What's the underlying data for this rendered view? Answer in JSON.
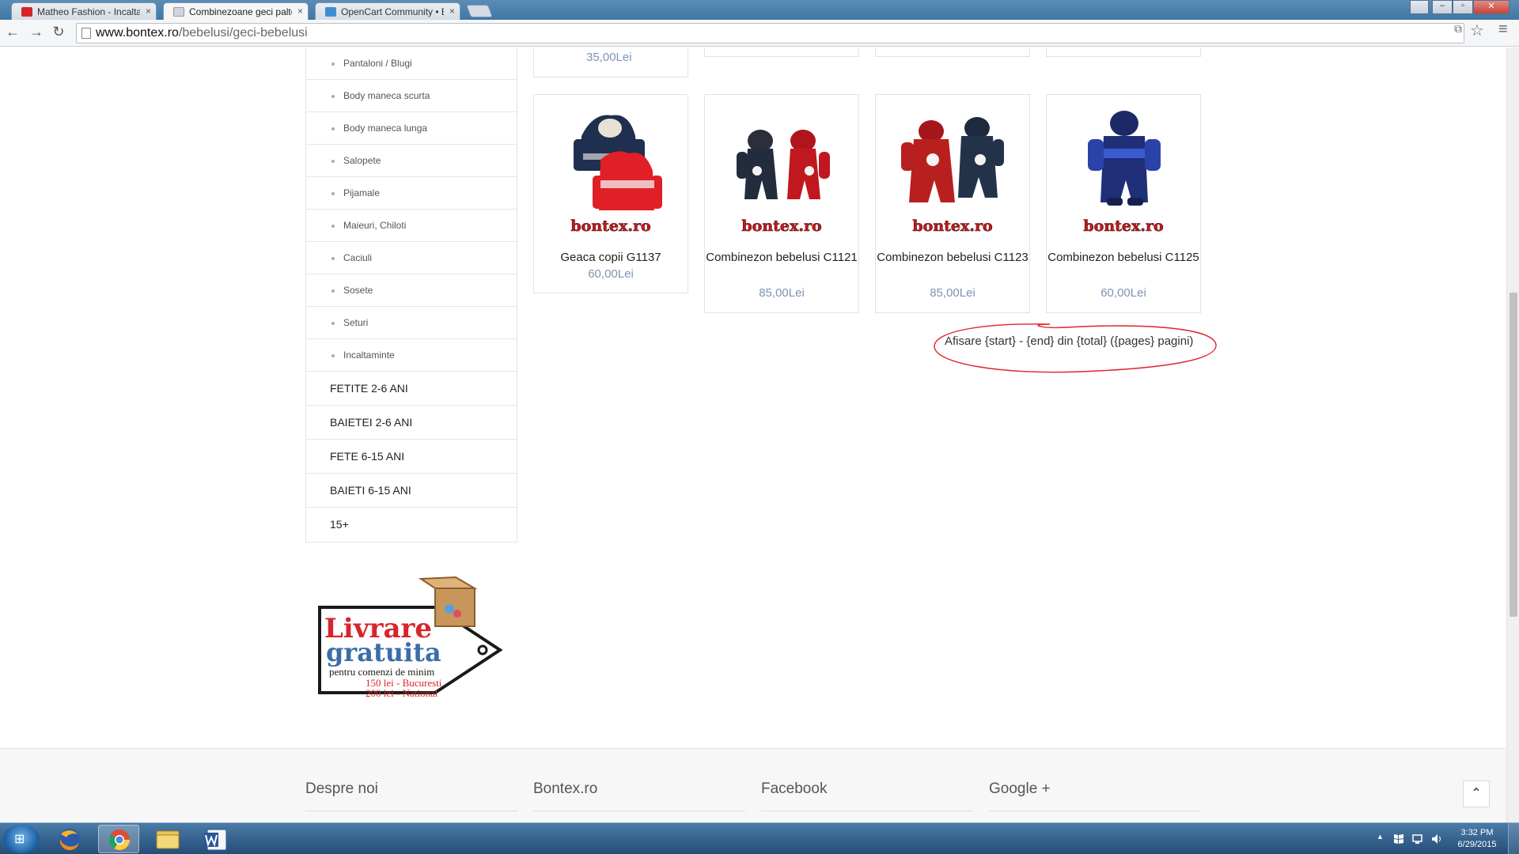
{
  "browser": {
    "tabs": [
      {
        "label": "Matheo Fashion - Incaltam"
      },
      {
        "label": "Combinezoane geci palton"
      },
      {
        "label": "OpenCart Community • Et"
      }
    ],
    "close_glyph": "×",
    "url_host": "www.bontex.ro",
    "url_path": "/bebelusi/geci-bebelusi",
    "nav_back": "←",
    "nav_forward": "→",
    "nav_reload": "↻",
    "star": "☆",
    "menu": "≡",
    "translate": "⧉",
    "win_min": "–",
    "win_max": "▫",
    "win_close": "✕",
    "icons": [
      "back-arrow-icon",
      "forward-arrow-icon",
      "reload-icon",
      "translate-icon",
      "bookmark-star-icon",
      "menu-icon"
    ]
  },
  "sidebar": {
    "subcategories": [
      "Pantaloni / Blugi",
      "Body maneca scurta",
      "Body maneca lunga",
      "Salopete",
      "Pijamale",
      "Maieuri, Chiloti",
      "Caciuli",
      "Sosete",
      "Seturi",
      "Incaltaminte"
    ],
    "categories": [
      "FETITE 2-6 ANI",
      "BAIETEI 2-6 ANI",
      "FETE 6-15 ANI",
      "BAIETI 6-15 ANI",
      "15+"
    ]
  },
  "promo": {
    "line1": "Livrare",
    "line2": "gratuita",
    "line3": "pentru comenzi de minim",
    "line4": "150 lei - Bucuresti",
    "line5": "200 lei - National"
  },
  "products": {
    "previous_row_price": "35,00Lei",
    "items": [
      {
        "name": "Geaca copii G1137",
        "price": "60,00Lei",
        "brand": "bontex.ro"
      },
      {
        "name": "Combinezon bebelusi C1121",
        "price": "85,00Lei",
        "brand": "bontex.ro"
      },
      {
        "name": "Combinezon bebelusi C1123",
        "price": "85,00Lei",
        "brand": "bontex.ro"
      },
      {
        "name": "Combinezon bebelusi C1125",
        "price": "60,00Lei",
        "brand": "bontex.ro"
      }
    ]
  },
  "pagination": {
    "text": "Afisare {start} - {end} din {total} ({pages} pagini)"
  },
  "footer": {
    "columns": [
      "Despre noi",
      "Bontex.ro",
      "Facebook",
      "Google +"
    ],
    "back_to_top": "⌃"
  },
  "taskbar": {
    "time": "3:32 PM",
    "date": "6/29/2015",
    "tray_arrow": "▲",
    "start_glyph": "⊞"
  },
  "colors": {
    "price": "#7f93b3",
    "annotation": "#e0232a",
    "taskbar": "#2f5f8d"
  }
}
